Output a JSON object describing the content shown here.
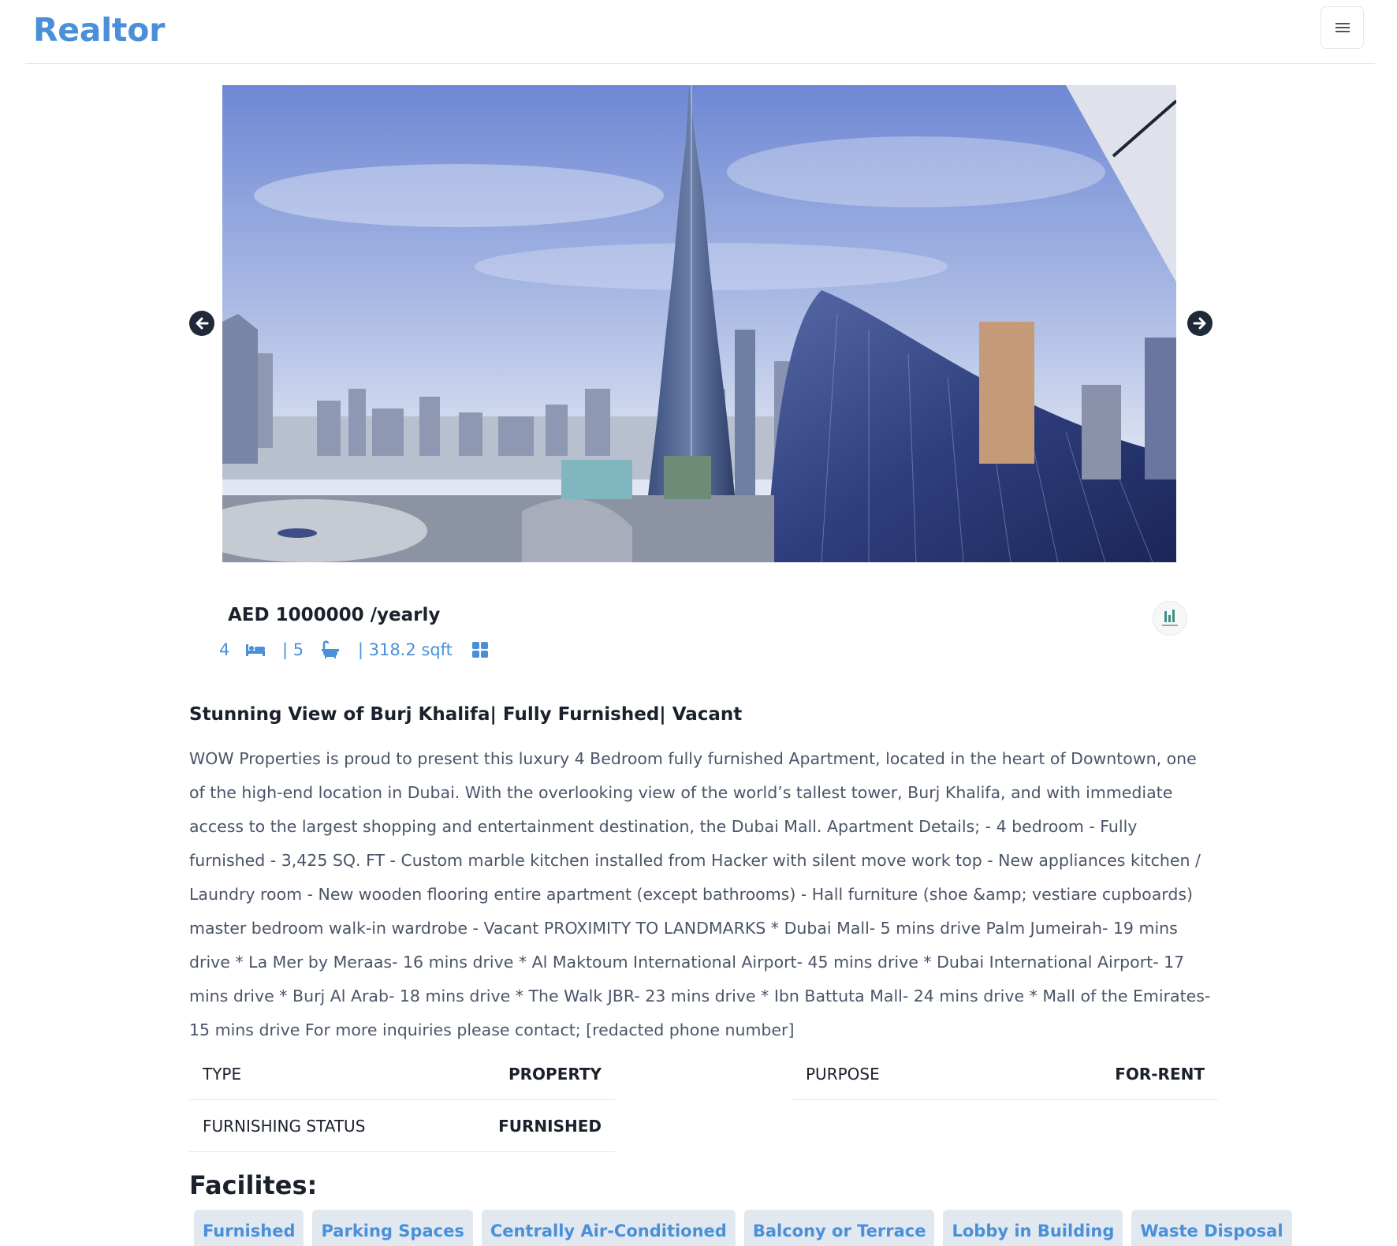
{
  "navbar": {
    "brand": "Realtor",
    "menu_icon": "hamburger-menu-icon"
  },
  "carousel": {
    "image_alt": "Burj Khalifa and Downtown Dubai skyline",
    "prev_icon": "arrow-left-circle-icon",
    "next_icon": "arrow-right-circle-icon"
  },
  "listing": {
    "price": "AED 1000000 /yearly",
    "rooms": "4",
    "baths": " | 5",
    "area": " | 318.2 sqft",
    "title": "Stunning View of Burj Khalifa| Fully Furnished| Vacant",
    "description": "WOW Properties is proud to present this luxury 4 Bedroom fully furnished Apartment, located in the heart of Downtown, one of the high-end location in Dubai. With the overlooking view of the world’s tallest tower, Burj Khalifa, and with immediate access to the largest shopping and entertainment destination, the Dubai Mall. Apartment Details; - 4 bedroom - Fully furnished - 3,425 SQ. FT - Custom marble kitchen installed from Hacker with silent move work top - New appliances kitchen / Laundry room - New wooden flooring entire apartment (except bathrooms) - Hall furniture (shoe &amp; vestiare cupboards) master bedroom walk-in wardrobe - Vacant PROXIMITY TO LANDMARKS * Dubai Mall- 5 mins drive Palm Jumeirah- 19 mins drive * La Mer by Meraas- 16 mins drive * Al Maktoum International Airport- 45 mins drive * Dubai International Airport- 17 mins drive * Burj Al Arab- 18 mins drive * The Walk JBR- 23 mins drive * Ibn Battuta Mall- 24 mins drive * Mall of the Emirates- 15 mins drive For more inquiries please contact; [redacted phone number]"
  },
  "details": {
    "type_label": "TYPE",
    "type_value": "PROPERTY",
    "purpose_label": "PURPOSE",
    "purpose_value": "FOR-RENT",
    "furnishing_label": "FURNISHING STATUS",
    "furnishing_value": "FURNISHED"
  },
  "facilities": {
    "heading": "Facilites:",
    "items": [
      "Furnished",
      "Parking Spaces",
      "Centrally Air-Conditioned",
      "Balcony or Terrace",
      "Lobby in Building",
      "Waste Disposal"
    ]
  },
  "colors": {
    "accent": "#4a90d9",
    "text": "#1a202c",
    "muted_text": "#4a5568",
    "tag_bg": "#e2e8f0"
  }
}
